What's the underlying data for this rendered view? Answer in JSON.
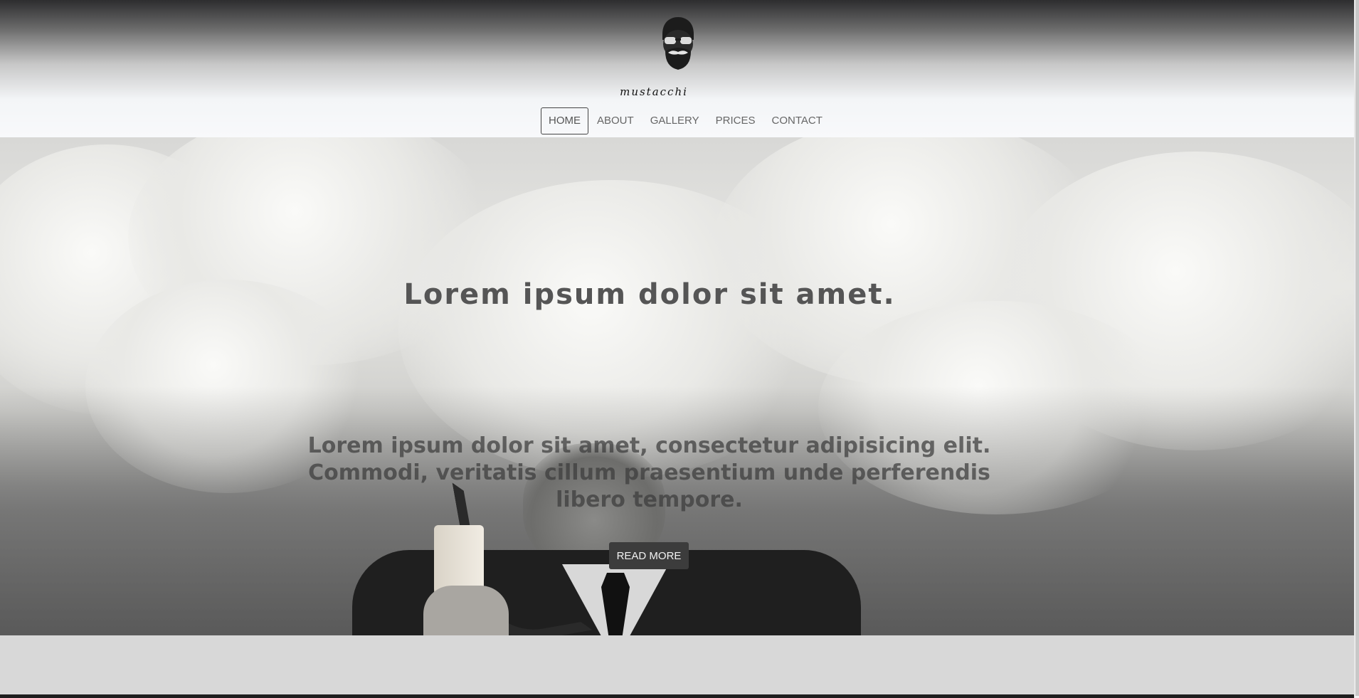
{
  "brand": {
    "name": "mustacchi",
    "logo_icon": "mustache-man-icon"
  },
  "nav": {
    "items": [
      {
        "label": "HOME",
        "active": true
      },
      {
        "label": "ABOUT",
        "active": false
      },
      {
        "label": "GALLERY",
        "active": false
      },
      {
        "label": "PRICES",
        "active": false
      },
      {
        "label": "CONTACT",
        "active": false
      }
    ]
  },
  "hero": {
    "title": "Lorem ipsum dolor sit amet.",
    "text": "Lorem ipsum dolor sit amet, consectetur adipisicing elit. Commodi, veritatis cillum praesentium unde perferendis libero tempore.",
    "button_label": "READ MORE"
  },
  "colors": {
    "button": "#3c3c3c",
    "nav_text": "#666666",
    "header_top": "#2d2d2f",
    "header_bottom": "#f8f9fb"
  }
}
